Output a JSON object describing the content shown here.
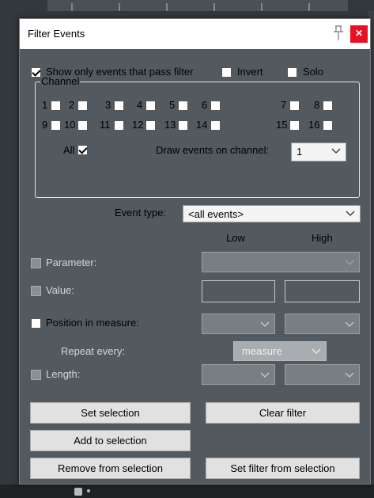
{
  "window": {
    "title": "Filter Events"
  },
  "filter": {
    "show_only_label": "Show only events that pass filter",
    "invert_label": "Invert",
    "solo_label": "Solo"
  },
  "channel": {
    "group_label": "Channel",
    "channels": [
      "1",
      "2",
      "3",
      "4",
      "5",
      "6",
      "7",
      "8",
      "9",
      "10",
      "11",
      "12",
      "13",
      "14",
      "15",
      "16"
    ],
    "all_label": "All",
    "draw_label": "Draw events on channel:",
    "draw_value": "1"
  },
  "event_type": {
    "label": "Event type:",
    "value": "<all events>"
  },
  "columns": {
    "low": "Low",
    "high": "High"
  },
  "rows": {
    "parameter_label": "Parameter:",
    "value_label": "Value:",
    "position_label": "Position in measure:",
    "repeat_label": "Repeat every:",
    "repeat_value": "measure",
    "length_label": "Length:"
  },
  "buttons": {
    "set_selection": "Set selection",
    "clear_filter": "Clear filter",
    "add_to_selection": "Add to selection",
    "remove_from_selection": "Remove from selection",
    "set_filter_from_selection": "Set filter from selection"
  },
  "colors": {
    "close_red": "#e81123",
    "panel": "#535a5f"
  }
}
